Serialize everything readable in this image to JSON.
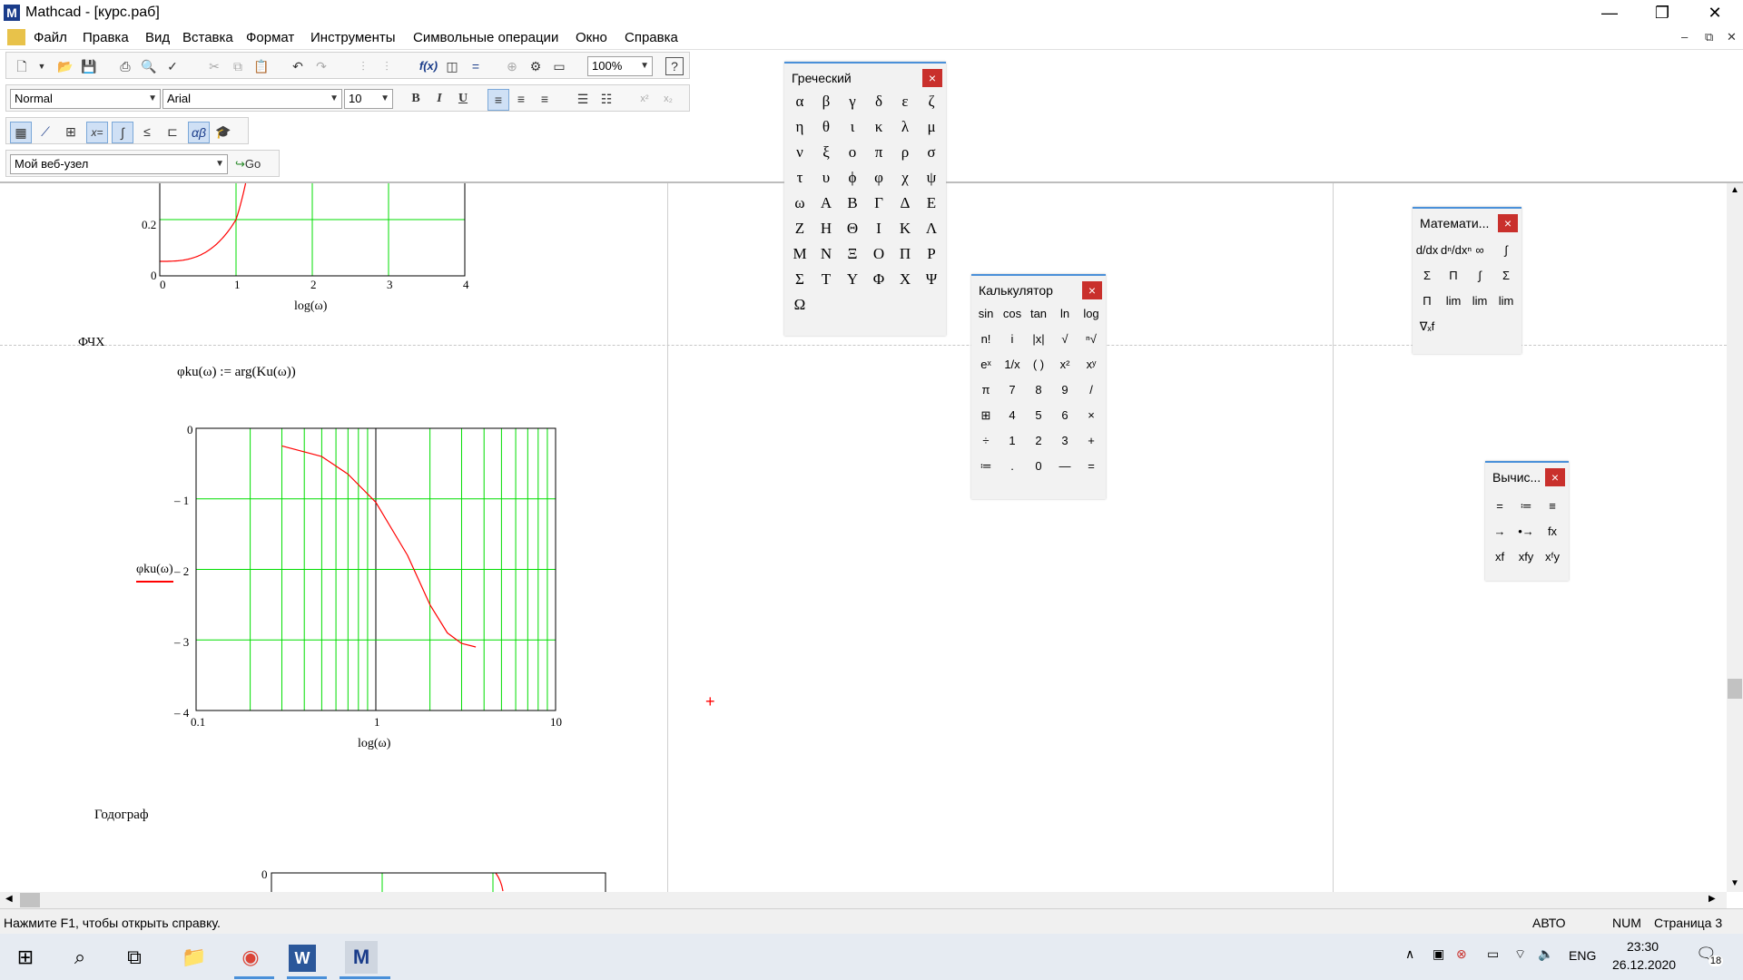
{
  "window": {
    "title": "Mathcad - [курс.раб]",
    "app_icon": "M",
    "controls": {
      "minimize": "—",
      "restore": "❐",
      "close": "✕"
    }
  },
  "menu": {
    "items": [
      "Файл",
      "Правка",
      "Вид",
      "Вставка",
      "Формат",
      "Инструменты",
      "Символьные операции",
      "Окно",
      "Справка"
    ],
    "mdi": {
      "minimize": "–",
      "restore": "⧉",
      "close": "✕"
    }
  },
  "toolbar": {
    "style_combo": "Normal",
    "font_combo": "Arial",
    "size_combo": "10",
    "zoom_combo": "100%",
    "web_combo": "Мой веб-узел",
    "go_label": "Go",
    "bold": "B",
    "italic": "I",
    "underline": "U"
  },
  "worksheet": {
    "section_fchh": "ФЧХ",
    "formula": "φku(ω) := arg(Ku(ω))",
    "section_hodograph": "Годограф",
    "plot1": {
      "y_ticks": [
        "0.2",
        "0"
      ],
      "x_ticks": [
        "0",
        "1",
        "2",
        "3",
        "4"
      ],
      "xlabel": "log(ω)"
    },
    "plot2": {
      "y_ticks": [
        "0",
        "– 1",
        "– 2",
        "– 3",
        "– 4"
      ],
      "x_ticks": [
        "0.1",
        "1",
        "10"
      ],
      "xlabel": "log(ω)",
      "ylabel": "φku(ω)"
    },
    "plot3": {
      "y_tick": "0"
    }
  },
  "chart_data": [
    {
      "type": "line",
      "x": [
        0,
        0.5,
        1,
        1.3
      ],
      "y": [
        0,
        0.04,
        0.2,
        0.45
      ],
      "xlabel": "log(ω)",
      "ylabel": "",
      "xlim": [
        0,
        4
      ],
      "ylim": [
        0,
        0.5
      ],
      "grid": true
    },
    {
      "type": "line",
      "x": [
        0.3,
        0.5,
        0.7,
        1.0,
        1.5,
        2.0,
        2.5,
        3.0,
        3.6
      ],
      "y": [
        -0.25,
        -0.4,
        -0.65,
        -1.05,
        -1.8,
        -2.5,
        -2.9,
        -3.05,
        -3.1
      ],
      "xlabel": "log(ω)",
      "ylabel": "φku(ω)",
      "xlim": [
        0.1,
        10
      ],
      "ylim": [
        -4,
        0
      ],
      "x_scale": "log",
      "grid": true
    }
  ],
  "palettes": {
    "greek": {
      "title": "Греческий",
      "cells": [
        "α",
        "β",
        "γ",
        "δ",
        "ε",
        "ζ",
        "η",
        "θ",
        "ι",
        "κ",
        "λ",
        "μ",
        "ν",
        "ξ",
        "ο",
        "π",
        "ρ",
        "σ",
        "τ",
        "υ",
        "ϕ",
        "φ",
        "χ",
        "ψ",
        "ω",
        "Α",
        "Β",
        "Γ",
        "Δ",
        "Ε",
        "Ζ",
        "Η",
        "Θ",
        "Ι",
        "Κ",
        "Λ",
        "Μ",
        "Ν",
        "Ξ",
        "Ο",
        "Π",
        "Ρ",
        "Σ",
        "Τ",
        "Υ",
        "Φ",
        "Χ",
        "Ψ",
        "Ω"
      ]
    },
    "calculator": {
      "title": "Калькулятор",
      "cells": [
        "sin",
        "cos",
        "tan",
        "ln",
        "log",
        "n!",
        "i",
        "|x|",
        "√",
        "ⁿ√",
        "eˣ",
        "1/x",
        "( )",
        "x²",
        "xʸ",
        "π",
        "7",
        "8",
        "9",
        "/",
        "⊞",
        "4",
        "5",
        "6",
        "×",
        "÷",
        "1",
        "2",
        "3",
        "+",
        "≔",
        ".",
        "0",
        "—",
        "="
      ]
    },
    "math": {
      "title": "Математи...",
      "cells": [
        "d/dx",
        "dⁿ/dxⁿ",
        "∞",
        "∫",
        "Σ",
        "Π",
        "∫",
        "Σ",
        "Π",
        "lim",
        "lim",
        "lim",
        "∇ₓf"
      ]
    },
    "evaluation": {
      "title": "Вычис...",
      "cells": [
        "=",
        "≔",
        "≡",
        "→",
        "•→",
        "fx",
        "xf",
        "xfy",
        "xᶠy"
      ]
    },
    "close_label": "×"
  },
  "status": {
    "help": "Нажмите F1, чтобы открыть справку.",
    "mode": "АВТО",
    "num": "NUM",
    "page": "Страница 3"
  },
  "taskbar": {
    "lang": "ENG",
    "time": "23:30",
    "date": "26.12.2020",
    "notifications": "18"
  },
  "colors": {
    "grid": "#00dd00",
    "trace": "#ff0000",
    "close_button": "#c9302c",
    "palette_border": "#4a90d9"
  }
}
